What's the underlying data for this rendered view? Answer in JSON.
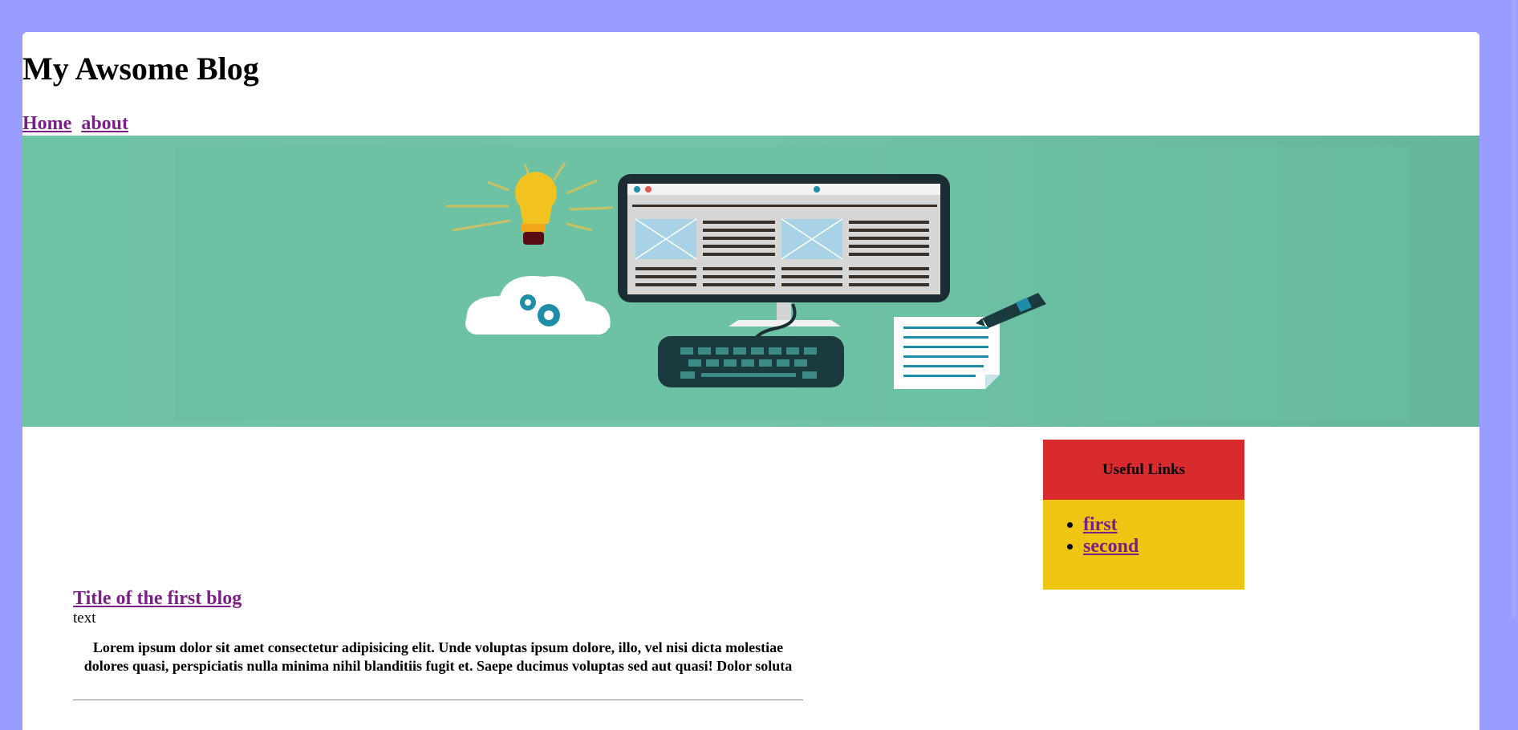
{
  "site": {
    "title": "My Awsome Blog"
  },
  "nav": {
    "items": [
      {
        "label": "Home"
      },
      {
        "label": "about"
      }
    ]
  },
  "sidebar": {
    "header": "Useful Links",
    "links": [
      {
        "label": "first"
      },
      {
        "label": "second"
      }
    ]
  },
  "post": {
    "title": "Title of the first blog",
    "subtitle": "text",
    "body": "Lorem ipsum dolor sit amet consectetur adipisicing elit. Unde voluptas ipsum dolore, illo, vel nisi dicta molestiae dolores quasi, perspiciatis nulla minima nihil blanditiis fugit et. Saepe ducimus voluptas sed aut quasi! Dolor soluta"
  },
  "colors": {
    "page_background": "#9b9cff",
    "hero_background": "#6fbfa3",
    "sidebar_header": "#d92b2d",
    "sidebar_body": "#efc514",
    "link": "#7b1f87"
  },
  "icons": [
    "lightbulb-icon",
    "cloud-gear-icon",
    "monitor-icon",
    "keyboard-icon",
    "document-pen-icon"
  ]
}
